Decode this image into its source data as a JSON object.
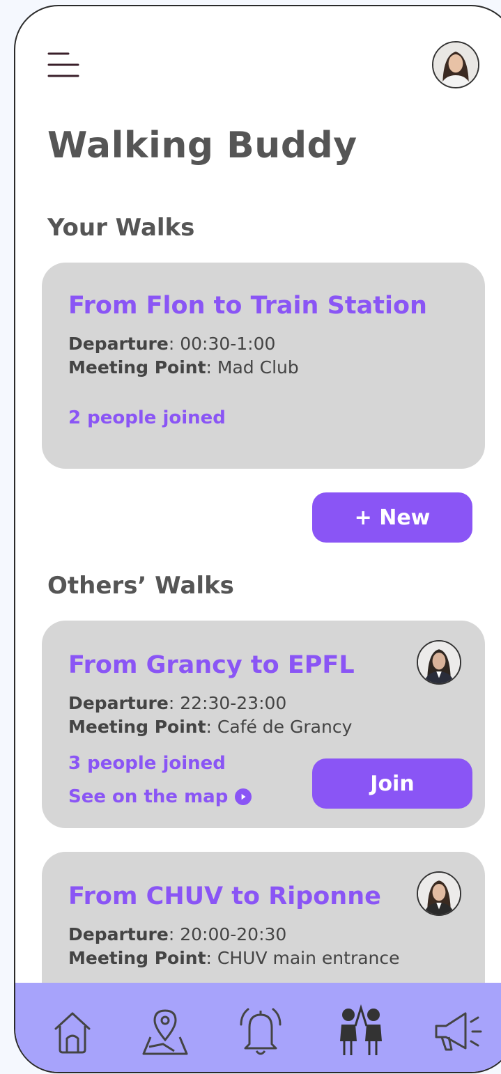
{
  "app": {
    "title": "Walking Buddy"
  },
  "your_walks": {
    "section_title": "Your Walks",
    "walk": {
      "title": "From Flon to Train Station",
      "departure_label": "Departure",
      "departure_value": ": 00:30-1:00",
      "meeting_label": "Meeting Point",
      "meeting_value": ": Mad Club",
      "joined": "2 people joined"
    },
    "new_button": "+ New"
  },
  "others_walks": {
    "section_title": "Others’ Walks",
    "walks": [
      {
        "title": "From Grancy to EPFL",
        "departure_label": "Departure",
        "departure_value": ": 22:30-23:00",
        "meeting_label": "Meeting Point",
        "meeting_value": ": Café de Grancy",
        "joined": "3 people joined",
        "map_link": "See on the map",
        "join_button": "Join"
      },
      {
        "title": "From CHUV to Riponne",
        "departure_label": "Departure",
        "departure_value": ": 20:00-20:30",
        "meeting_label": "Meeting Point",
        "meeting_value": ": CHUV main entrance"
      }
    ]
  },
  "nav": [
    "home-icon",
    "map-pin-icon",
    "bell-icon",
    "buddies-icon",
    "megaphone-icon"
  ],
  "colors": {
    "accent": "#8a55f5",
    "card": "#d6d6d6",
    "nav": "#a7a3fb",
    "text": "#555555"
  }
}
